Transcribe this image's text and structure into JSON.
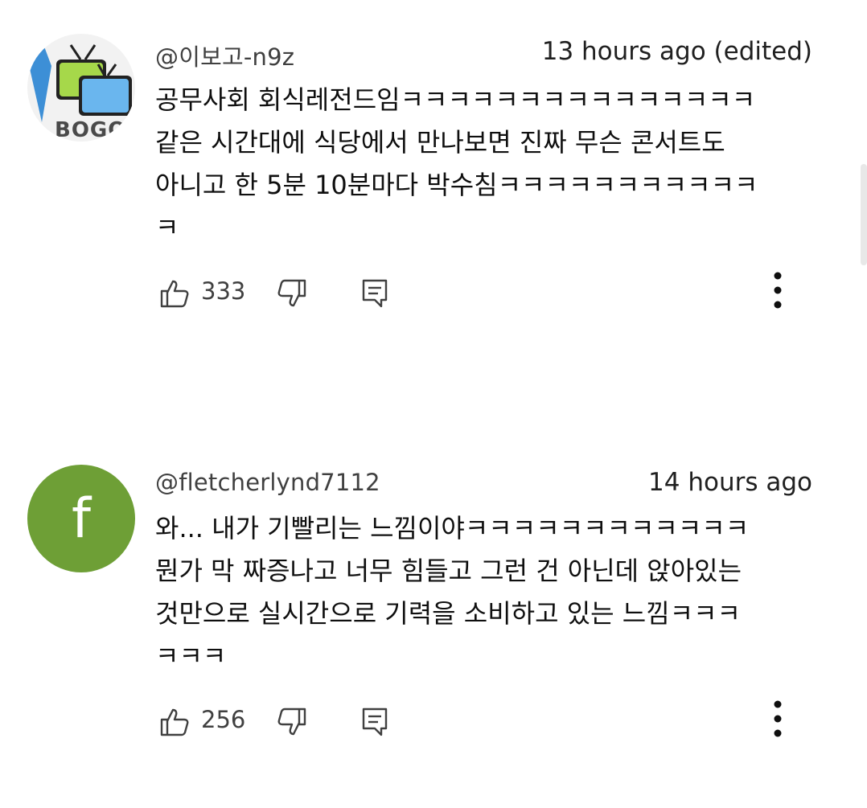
{
  "comments": [
    {
      "author": "@이보고-n9z",
      "time": "13 hours ago (edited)",
      "avatar_text": "BOGO",
      "lines": [
        "공무사회 회식레전드임ㅋㅋㅋㅋㅋㅋㅋㅋㅋㅋㅋㅋㅋㅋㅋ",
        "같은 시간대에 식당에서 만나보면 진짜 무슨 콘서트도",
        "아니고 한 5분 10분마다 박수침ㅋㅋㅋㅋㅋㅋㅋㅋㅋㅋㅋ",
        "ㅋ"
      ],
      "likes": "333"
    },
    {
      "author": "@fletcherlynd7112",
      "time": "14 hours ago",
      "avatar_letter": "f",
      "lines": [
        "와... 내가 기빨리는 느낌이야ㅋㅋㅋㅋㅋㅋㅋㅋㅋㅋㅋㅋ",
        "뭔가 막 짜증나고 너무 힘들고 그런 건 아닌데 앉아있는",
        "것만으로 실시간으로 기력을 소비하고 있는 느낌ㅋㅋㅋ",
        "ㅋㅋㅋ"
      ],
      "likes": "256"
    }
  ],
  "colors": {
    "avatar_green": "#6e9f36",
    "icon_gray": "#404040",
    "text": "#0f0f0f"
  },
  "icons": [
    "thumbs-up-icon",
    "thumbs-down-icon",
    "reply-icon",
    "more-vert-icon"
  ]
}
